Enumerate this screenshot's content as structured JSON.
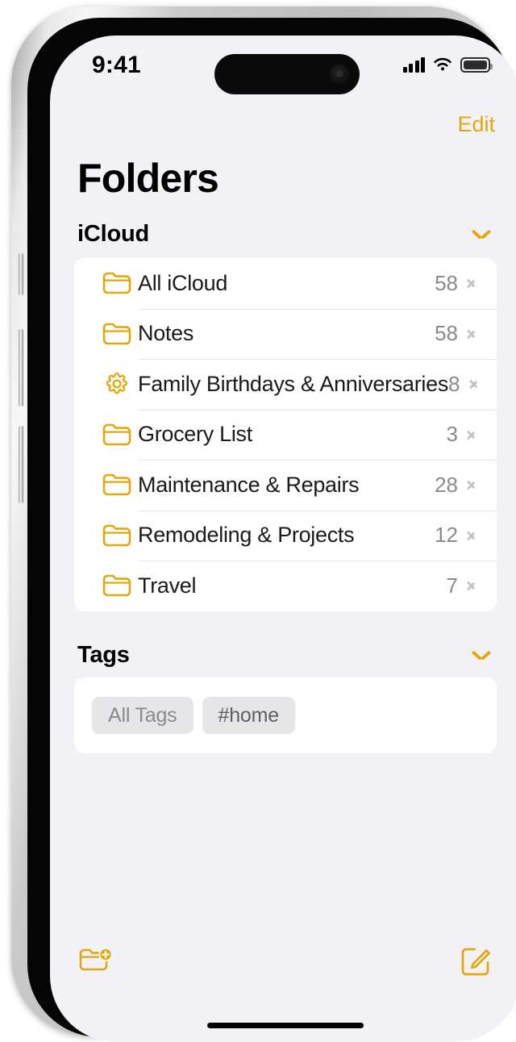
{
  "status_bar": {
    "time": "9:41",
    "signal_icon": "cellular-signal-icon",
    "wifi_icon": "wifi-icon",
    "battery_icon": "battery-full-icon"
  },
  "nav": {
    "edit_label": "Edit",
    "title": "Folders"
  },
  "sections": {
    "icloud": {
      "title": "iCloud",
      "collapse_icon": "chevron-down-icon"
    },
    "tags": {
      "title": "Tags",
      "collapse_icon": "chevron-down-icon"
    }
  },
  "folders": [
    {
      "name": "All iCloud",
      "count": "58",
      "icon": "folder-icon"
    },
    {
      "name": "Notes",
      "count": "58",
      "icon": "folder-icon"
    },
    {
      "name": "Family Birthdays & Anniversaries",
      "count": "8",
      "icon": "gear-icon"
    },
    {
      "name": "Grocery List",
      "count": "3",
      "icon": "folder-icon"
    },
    {
      "name": "Maintenance & Repairs",
      "count": "28",
      "icon": "folder-icon"
    },
    {
      "name": "Remodeling & Projects",
      "count": "12",
      "icon": "folder-icon"
    },
    {
      "name": "Travel",
      "count": "7",
      "icon": "folder-icon"
    }
  ],
  "tags": [
    {
      "label": "All Tags",
      "style": "muted"
    },
    {
      "label": "#home",
      "style": "strong"
    }
  ],
  "toolbar": {
    "new_folder_icon": "new-folder-icon",
    "compose_icon": "compose-note-icon"
  },
  "colors": {
    "accent": "#E3A70D",
    "screen_background": "#F2F2F6",
    "card_background": "#FFFFFF",
    "secondary_text": "#8A8A8E",
    "separator": "#E7E7EA",
    "pill_background": "#E6E6E9"
  }
}
